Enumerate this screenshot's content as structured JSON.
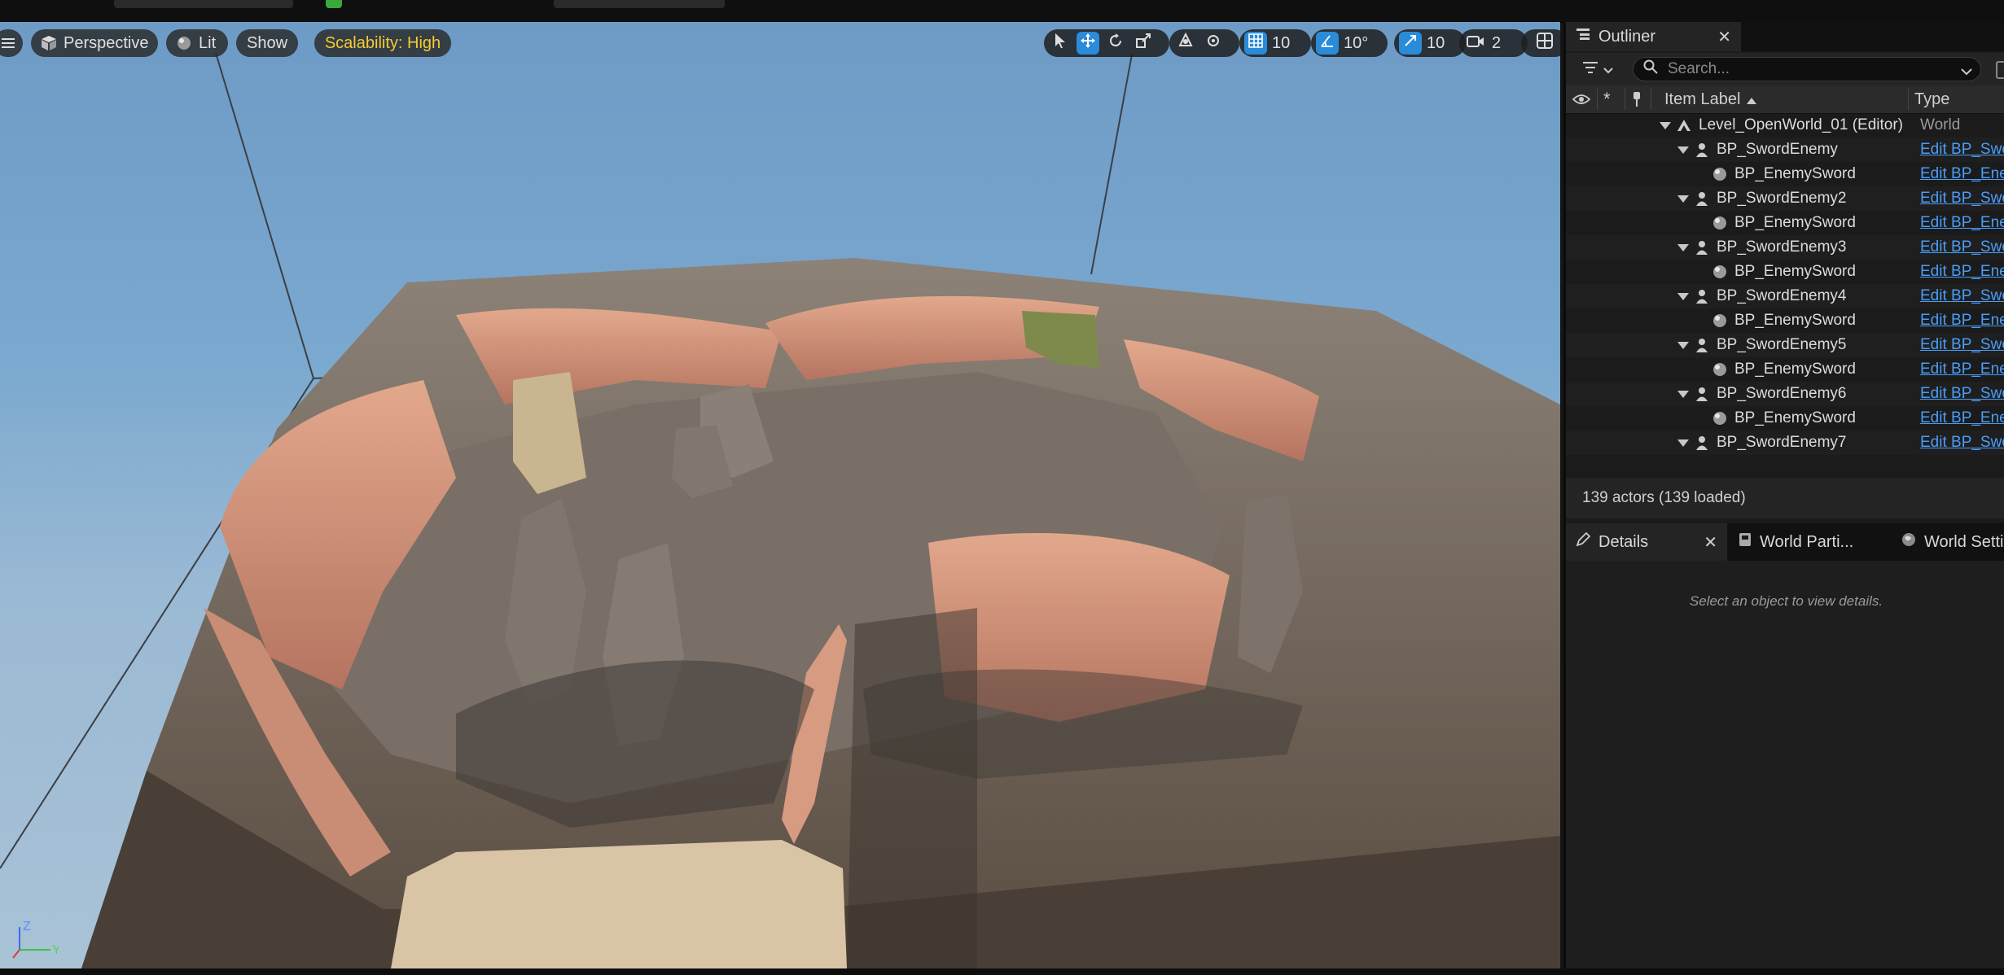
{
  "viewport": {
    "menu_icon": "hamburger-menu-icon",
    "perspective_label": "Perspective",
    "lit_label": "Lit",
    "show_label": "Show",
    "scalability_label": "Scalability: High",
    "grid_snap_value": "10",
    "rotation_snap_value": "10°",
    "scale_snap_value": "10",
    "camera_speed_value": "2",
    "accent_color": "#2a8bd8",
    "scalability_color": "#f3cc2f"
  },
  "outliner": {
    "tab_label": "Outliner",
    "search_placeholder": "Search...",
    "col_item_label": "Item Label",
    "col_type": "Type",
    "rows": [
      {
        "label": "Level_OpenWorld_01 (Editor)",
        "type": "World"
      },
      {
        "label": "BP_SwordEnemy",
        "type": "Edit BP_SwordEnemy"
      },
      {
        "label": "BP_EnemySword",
        "type": "Edit BP_EnemySword"
      },
      {
        "label": "BP_SwordEnemy2",
        "type": "Edit BP_SwordEnemy"
      },
      {
        "label": "BP_EnemySword",
        "type": "Edit BP_EnemySword"
      },
      {
        "label": "BP_SwordEnemy3",
        "type": "Edit BP_SwordEnemy"
      },
      {
        "label": "BP_EnemySword",
        "type": "Edit BP_EnemySword"
      },
      {
        "label": "BP_SwordEnemy4",
        "type": "Edit BP_SwordEnemy"
      },
      {
        "label": "BP_EnemySword",
        "type": "Edit BP_EnemySword"
      },
      {
        "label": "BP_SwordEnemy5",
        "type": "Edit BP_SwordEnemy"
      },
      {
        "label": "BP_EnemySword",
        "type": "Edit BP_EnemySword"
      },
      {
        "label": "BP_SwordEnemy6",
        "type": "Edit BP_SwordEnemy"
      },
      {
        "label": "BP_EnemySword",
        "type": "Edit BP_EnemySword"
      },
      {
        "label": "BP_SwordEnemy7",
        "type": "Edit BP_SwordEnemy"
      }
    ],
    "status": "139 actors (139 loaded)"
  },
  "details": {
    "tab_label": "Details",
    "world_partition_tab": "World Parti...",
    "world_settings_tab": "World Setti...",
    "empty_message": "Select an object to view details."
  },
  "axis": {
    "z_label": "Z",
    "y_label": "Y"
  }
}
